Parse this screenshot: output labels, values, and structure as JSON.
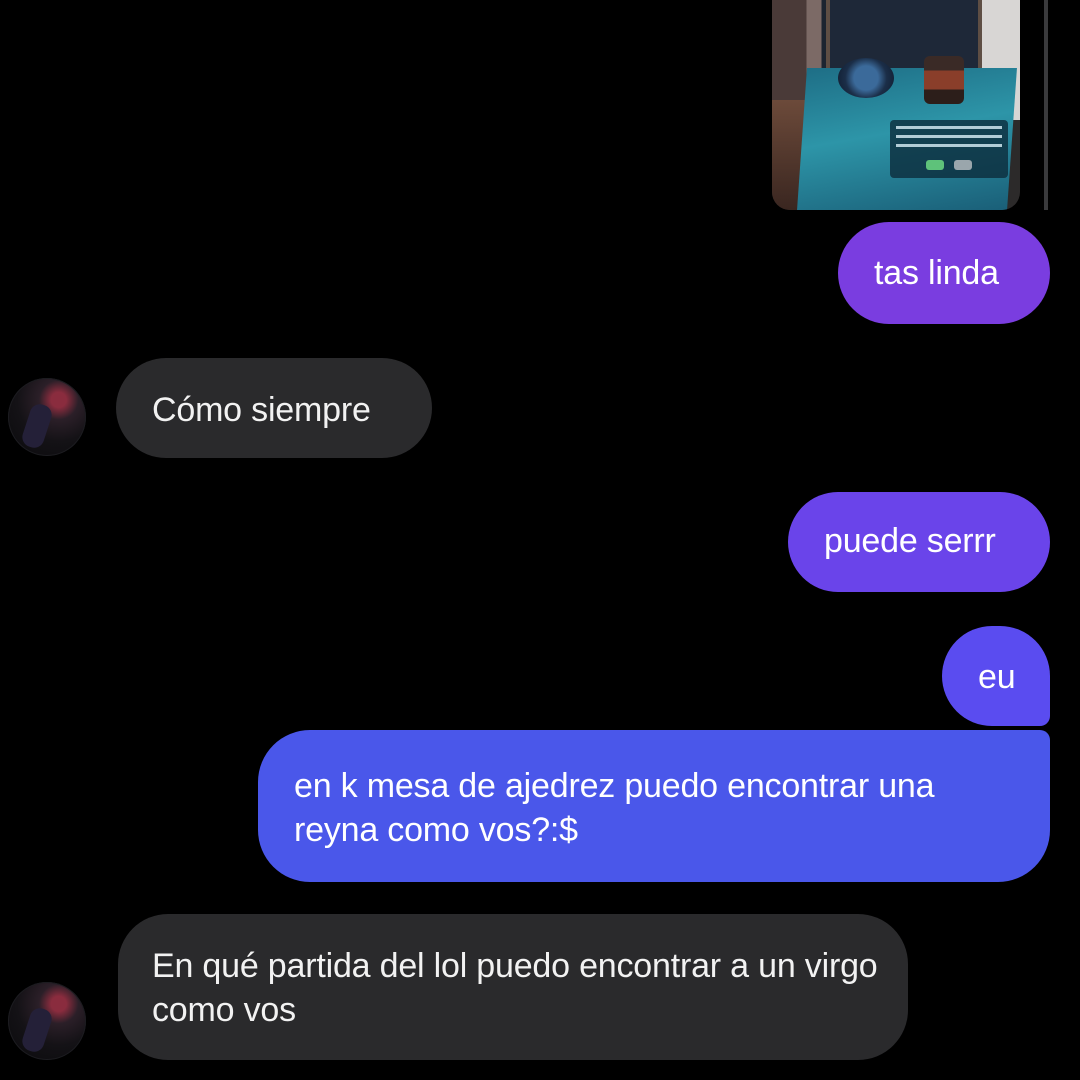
{
  "conversation": {
    "shared_image": "shared-photo",
    "messages": [
      {
        "direction": "sent",
        "text": "tas linda"
      },
      {
        "direction": "received",
        "text": "Cómo siempre"
      },
      {
        "direction": "sent",
        "text": "puede serrr"
      },
      {
        "direction": "sent",
        "text": "eu"
      },
      {
        "direction": "sent",
        "text": "en k mesa de ajedrez puedo encontrar una reyna como vos?:$"
      },
      {
        "direction": "received",
        "text": "En qué partida del lol puedo encontrar a un virgo como vos"
      }
    ]
  },
  "colors": {
    "background": "#000000",
    "received_bubble": "#2a2a2c",
    "sent_gradient": [
      "#7a3de0",
      "#6a44ea",
      "#5a4cf0",
      "#4a57ea"
    ],
    "text": "#ffffff"
  }
}
